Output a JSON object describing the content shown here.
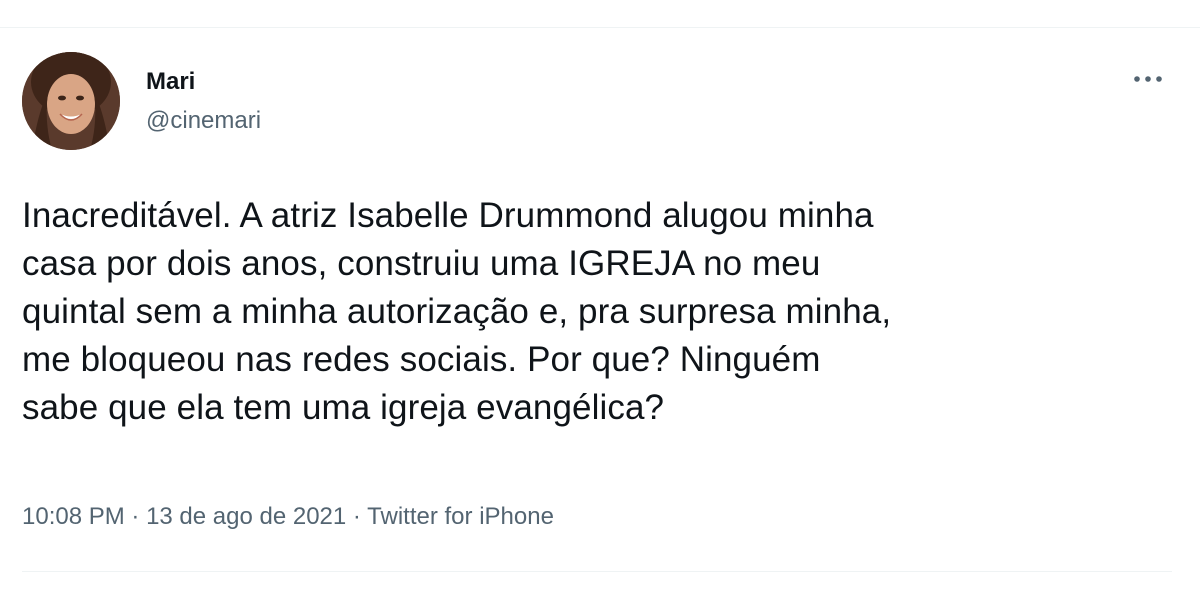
{
  "tweet": {
    "author": {
      "name": "Mari",
      "handle": "@cinemari"
    },
    "more_icon": "ellipsis-icon",
    "text_lines": [
      "Inacreditável. A atriz Isabelle Drummond alugou minha",
      "casa por dois anos, construiu uma IGREJA no meu",
      "quintal sem a minha autorização e, pra surpresa minha,",
      "me bloqueou nas redes sociais. Por que? Ninguém",
      "sabe que ela tem uma igreja evangélica?"
    ],
    "meta": {
      "time": "10:08 PM",
      "separator": " · ",
      "date": "13 de ago de 2021",
      "source": "Twitter for iPhone"
    }
  },
  "colors": {
    "text": "#0f1419",
    "secondary": "#536471",
    "divider": "#eff3f4"
  }
}
